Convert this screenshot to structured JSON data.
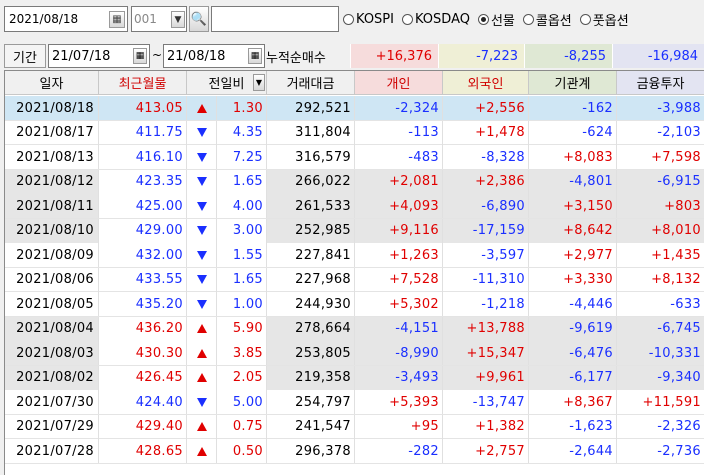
{
  "toolbar": {
    "date": "2021/08/18",
    "code": "001",
    "name": "",
    "radios": [
      {
        "label": "KOSPI",
        "selected": false
      },
      {
        "label": "KOSDAQ",
        "selected": false
      },
      {
        "label": "선물",
        "selected": true
      },
      {
        "label": "콜옵션",
        "selected": false
      },
      {
        "label": "풋옵션",
        "selected": false
      }
    ]
  },
  "period": {
    "label": "기간",
    "from": "21/07/18",
    "tilde": "~",
    "to": "21/08/18",
    "cum_label": "누적순매수",
    "sums": [
      "+16,376",
      "-7,223",
      "-8,255",
      "-16,984"
    ]
  },
  "headers": [
    "일자",
    "최근월물",
    "전일비",
    "",
    "거래대금",
    "개인",
    "외국인",
    "기관계",
    "금융투자"
  ],
  "rows": [
    {
      "date": "2021/08/18",
      "price": "413.05",
      "dir": "up",
      "chg": "1.30",
      "vol": "292,521",
      "ind": "-2,324",
      "for": "+2,556",
      "inst": "-162",
      "fin": "-3,988",
      "style": "sel"
    },
    {
      "date": "2021/08/17",
      "price": "411.75",
      "dir": "dn",
      "chg": "4.35",
      "vol": "311,804",
      "ind": "-113",
      "for": "+1,478",
      "inst": "-624",
      "fin": "-2,103",
      "style": "white"
    },
    {
      "date": "2021/08/13",
      "price": "416.10",
      "dir": "dn",
      "chg": "7.25",
      "vol": "316,579",
      "ind": "-483",
      "for": "-8,328",
      "inst": "+8,083",
      "fin": "+7,598",
      "style": "white"
    },
    {
      "date": "2021/08/12",
      "price": "423.35",
      "dir": "dn",
      "chg": "1.65",
      "vol": "266,022",
      "ind": "+2,081",
      "for": "+2,386",
      "inst": "-4,801",
      "fin": "-6,915",
      "style": "gray"
    },
    {
      "date": "2021/08/11",
      "price": "425.00",
      "dir": "dn",
      "chg": "4.00",
      "vol": "261,533",
      "ind": "+4,093",
      "for": "-6,890",
      "inst": "+3,150",
      "fin": "+803",
      "style": "gray"
    },
    {
      "date": "2021/08/10",
      "price": "429.00",
      "dir": "dn",
      "chg": "3.00",
      "vol": "252,985",
      "ind": "+9,116",
      "for": "-17,159",
      "inst": "+8,642",
      "fin": "+8,010",
      "style": "gray"
    },
    {
      "date": "2021/08/09",
      "price": "432.00",
      "dir": "dn",
      "chg": "1.55",
      "vol": "227,841",
      "ind": "+1,263",
      "for": "-3,597",
      "inst": "+2,977",
      "fin": "+1,435",
      "style": "white"
    },
    {
      "date": "2021/08/06",
      "price": "433.55",
      "dir": "dn",
      "chg": "1.65",
      "vol": "227,968",
      "ind": "+7,528",
      "for": "-11,310",
      "inst": "+3,330",
      "fin": "+8,132",
      "style": "white"
    },
    {
      "date": "2021/08/05",
      "price": "435.20",
      "dir": "dn",
      "chg": "1.00",
      "vol": "244,930",
      "ind": "+5,302",
      "for": "-1,218",
      "inst": "-4,446",
      "fin": "-633",
      "style": "white"
    },
    {
      "date": "2021/08/04",
      "price": "436.20",
      "dir": "up",
      "chg": "5.90",
      "vol": "278,664",
      "ind": "-4,151",
      "for": "+13,788",
      "inst": "-9,619",
      "fin": "-6,745",
      "style": "gray"
    },
    {
      "date": "2021/08/03",
      "price": "430.30",
      "dir": "up",
      "chg": "3.85",
      "vol": "253,805",
      "ind": "-8,990",
      "for": "+15,347",
      "inst": "-6,476",
      "fin": "-10,331",
      "style": "gray"
    },
    {
      "date": "2021/08/02",
      "price": "426.45",
      "dir": "up",
      "chg": "2.05",
      "vol": "219,358",
      "ind": "-3,493",
      "for": "+9,961",
      "inst": "-6,177",
      "fin": "-9,340",
      "style": "gray"
    },
    {
      "date": "2021/07/30",
      "price": "424.40",
      "dir": "dn",
      "chg": "5.00",
      "vol": "254,797",
      "ind": "+5,393",
      "for": "-13,747",
      "inst": "+8,367",
      "fin": "+11,591",
      "style": "white"
    },
    {
      "date": "2021/07/29",
      "price": "429.40",
      "dir": "up",
      "chg": "0.75",
      "vol": "241,547",
      "ind": "+95",
      "for": "+1,382",
      "inst": "-1,623",
      "fin": "-2,326",
      "style": "white"
    },
    {
      "date": "2021/07/28",
      "price": "428.65",
      "dir": "up",
      "chg": "0.50",
      "vol": "296,378",
      "ind": "-282",
      "for": "+2,757",
      "inst": "-2,644",
      "fin": "-2,736",
      "style": "white"
    }
  ],
  "colors": {
    "up": "#e00000",
    "down": "#1a2fff",
    "selected_row": "#cfe6f4"
  }
}
